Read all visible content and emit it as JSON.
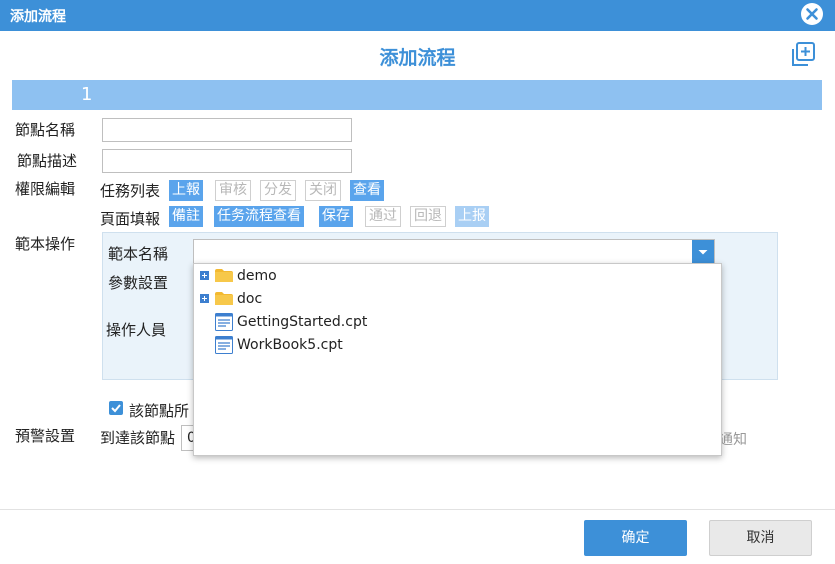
{
  "window": {
    "title": "添加流程"
  },
  "dialog": {
    "heading": "添加流程",
    "step_number": "1"
  },
  "form": {
    "node_name_label": "節點名稱",
    "node_desc_label": "節點描述",
    "permission_label": "權限編輯",
    "task_list_label": "任務列表",
    "task_list_buttons": [
      {
        "label": "上報",
        "state": "active"
      },
      {
        "label": "审核",
        "state": "inactive"
      },
      {
        "label": "分发",
        "state": "inactive"
      },
      {
        "label": "关闭",
        "state": "inactive"
      },
      {
        "label": "查看",
        "state": "active"
      }
    ],
    "page_fill_label": "頁面填報",
    "page_fill_buttons": [
      {
        "label": "備註",
        "state": "active"
      },
      {
        "label": "任务流程查看",
        "state": "active"
      },
      {
        "label": "保存",
        "state": "active"
      },
      {
        "label": "通过",
        "state": "inactive"
      },
      {
        "label": "回退",
        "state": "inactive"
      },
      {
        "label": "上报",
        "state": "faint"
      }
    ],
    "template_op_label": "範本操作",
    "template_name_label": "範本名稱",
    "template_name_value": "",
    "param_settings_label": "參數設置",
    "operator_label": "操作人員",
    "checkbox_label": "該節點所",
    "checkbox_checked": true,
    "warning_label": "預警設置",
    "arrive_label": "到達該節點",
    "arrive_value": "0",
    "notify_text": "通知"
  },
  "dropdown_tree": [
    {
      "label": "demo",
      "type": "folder",
      "expandable": true
    },
    {
      "label": "doc",
      "type": "folder",
      "expandable": true
    },
    {
      "label": "GettingStarted.cpt",
      "type": "file",
      "expandable": false
    },
    {
      "label": "WorkBook5.cpt",
      "type": "file",
      "expandable": false
    }
  ],
  "footer": {
    "ok_label": "确定",
    "cancel_label": "取消"
  },
  "colors": {
    "accent": "#3d90d8",
    "step_bar": "#8ec1f1",
    "panel_bg": "#eaf3fa",
    "button_active": "#5aa4ec"
  }
}
